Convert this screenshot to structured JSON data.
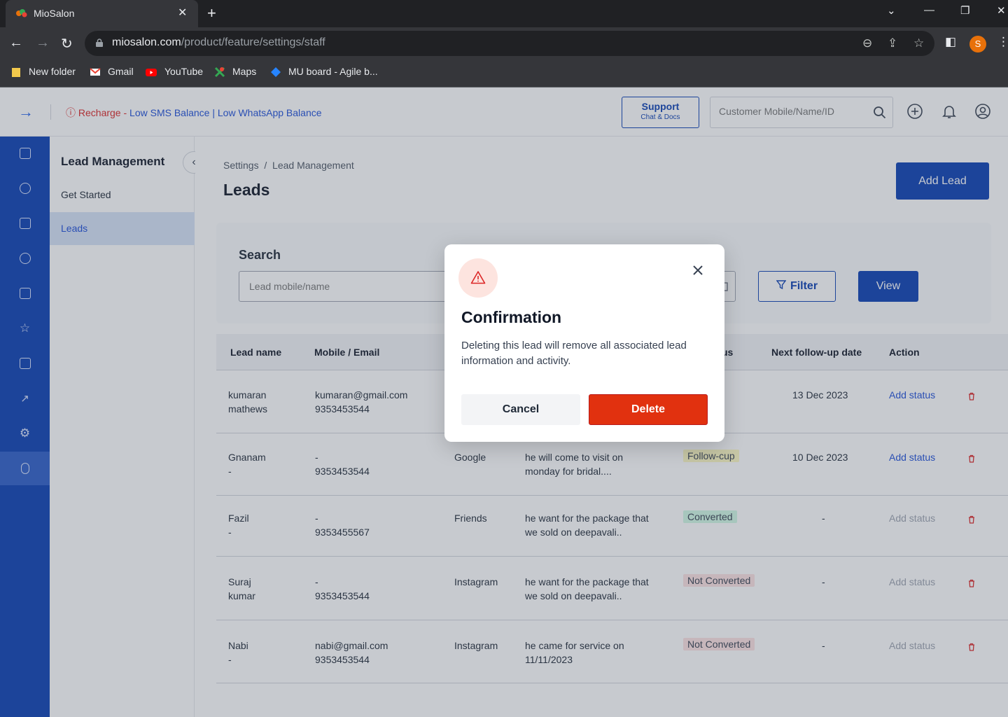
{
  "browser": {
    "tab_title": "MioSalon",
    "url_domain": "miosalon.com",
    "url_path": "/product/feature/settings/staff",
    "profile_initial": "S",
    "bookmarks": [
      "New folder",
      "Gmail",
      "YouTube",
      "Maps",
      "MU board - Agile b..."
    ]
  },
  "topnav": {
    "alert_prefix": "Recharge - ",
    "alert_sms": "Low SMS Balance",
    "alert_sep": " | ",
    "alert_whatsapp": "Low WhatsApp Balance",
    "support_title": "Support",
    "support_sub": "Chat & Docs",
    "customer_search_placeholder": "Customer Mobile/Name/ID"
  },
  "sidebar": {
    "title": "Lead Management",
    "items": [
      "Get Started",
      "Leads"
    ]
  },
  "main": {
    "breadcrumb": "Settings  /  Lead Management",
    "title": "Leads",
    "add_lead": "Add Lead",
    "search_label": "Search",
    "search_value": "Lead mobile/name",
    "filter": "Filter",
    "view": "View"
  },
  "table": {
    "headers": [
      "Lead name",
      "Mobile / Email",
      "us",
      "Next follow-up date",
      "Action"
    ],
    "rows": [
      {
        "name1": "kumaran",
        "name2": "mathews",
        "contact1": "kumaran@gmail.com",
        "contact2": "9353453544",
        "source": "",
        "note1": "",
        "note2": "",
        "status": "",
        "date": "13 Dec 2023",
        "action": "Add status"
      },
      {
        "name1": "Gnanam",
        "name2": "-",
        "contact1": "-",
        "contact2": "9353453544",
        "source": "Google",
        "note1": "he will come to visit on",
        "note2": "monday for bridal....",
        "status": "Follow-cup",
        "date": "10 Dec 2023",
        "action": "Add status"
      },
      {
        "name1": "Fazil",
        "name2": "-",
        "contact1": "-",
        "contact2": "9353455567",
        "source": "Friends",
        "note1": "he want for the package that",
        "note2": "we sold on deepavali..",
        "status": "Converted",
        "date": "-",
        "action": "Add status"
      },
      {
        "name1": "Suraj",
        "name2": "kumar",
        "contact1": "-",
        "contact2": "9353453544",
        "source": "Instagram",
        "note1": "he want for the package that",
        "note2": "we sold on deepavali..",
        "status": "Not Converted",
        "date": "-",
        "action": "Add status"
      },
      {
        "name1": "Nabi",
        "name2": "-",
        "contact1": "nabi@gmail.com",
        "contact2": "9353453544",
        "source": "Instagram",
        "note1": "he came for service on",
        "note2": "11/11/2023",
        "status": "Not Converted",
        "date": "-",
        "action": "Add status"
      }
    ]
  },
  "modal": {
    "title": "Confirmation",
    "message": "Deleting this lead will remove all associated lead information and activity.",
    "cancel": "Cancel",
    "delete": "Delete"
  },
  "colors": {
    "brand": "#0b3fb3",
    "danger": "#e1310f",
    "link": "#1d4ed8"
  },
  "icons": [
    "arrow-right-icon",
    "alert-circle-icon",
    "search-icon",
    "add-circle-icon",
    "bell-icon",
    "user-icon",
    "chevron-left-icon",
    "filter-icon",
    "calendar-icon",
    "trash-icon",
    "warning-icon",
    "close-icon"
  ]
}
